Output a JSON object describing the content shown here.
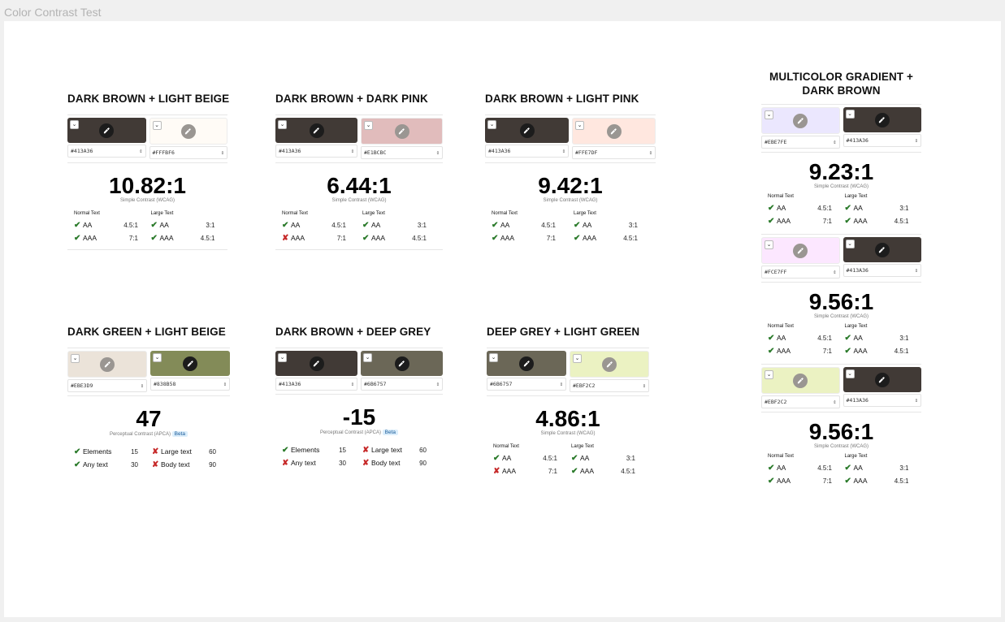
{
  "frame_title": "Color Contrast Test",
  "cards": {
    "c1": {
      "title": "DARK BROWN + LIGHT BEIGE",
      "left": {
        "hex": "#413A36",
        "color": "#413A36"
      },
      "right": {
        "hex": "#FFFBF6",
        "color": "#FFFBF6"
      },
      "score": "10.82:1",
      "score_label": "Simple Contrast (WCAG)",
      "normal_head": "Normal Text",
      "large_head": "Large Text",
      "rows": [
        {
          "n_label": "AA",
          "n_val": "4.5:1",
          "l_label": "AA",
          "l_val": "3:1"
        },
        {
          "n_label": "AAA",
          "n_val": "7:1",
          "l_label": "AAA",
          "l_val": "4.5:1"
        }
      ]
    },
    "c2": {
      "title": "DARK BROWN + DARK PINK",
      "left": {
        "hex": "#413A36",
        "color": "#413A36"
      },
      "right": {
        "hex": "#E1BCBC",
        "color": "#E1BCBC"
      },
      "score": "6.44:1",
      "score_label": "Simple Contrast (WCAG)",
      "normal_head": "Normal Text",
      "large_head": "Large Text",
      "rows": [
        {
          "n_label": "AA",
          "n_val": "4.5:1",
          "l_label": "AA",
          "l_val": "3:1"
        },
        {
          "n_label": "AAA",
          "n_val": "7:1",
          "l_label": "AAA",
          "l_val": "4.5:1"
        }
      ]
    },
    "c3": {
      "title": "DARK BROWN + LIGHT PINK",
      "left": {
        "hex": "#413A36",
        "color": "#413A36"
      },
      "right": {
        "hex": "#FFE7DF",
        "color": "#FFE7DF"
      },
      "score": "9.42:1",
      "score_label": "Simple Contrast (WCAG)",
      "normal_head": "Normal Text",
      "large_head": "Large Text",
      "rows": [
        {
          "n_label": "AA",
          "n_val": "4.5:1",
          "l_label": "AA",
          "l_val": "3:1"
        },
        {
          "n_label": "AAA",
          "n_val": "7:1",
          "l_label": "AAA",
          "l_val": "4.5:1"
        }
      ]
    },
    "c4": {
      "title": "DARK GREEN + LIGHT BEIGE",
      "left": {
        "hex": "#EBE3D9",
        "color": "#EBE3D9"
      },
      "right": {
        "hex": "#838B58",
        "color": "#838B58"
      },
      "score": "47",
      "score_label": "Perceptual Contrast (APCA)",
      "beta": "Beta",
      "rows": [
        {
          "n_label": "Elements",
          "n_val": "15",
          "l_label": "Large text",
          "l_val": "60"
        },
        {
          "n_label": "Any text",
          "n_val": "30",
          "l_label": "Body text",
          "l_val": "90"
        }
      ]
    },
    "c5": {
      "title": "DARK BROWN + DEEP GREY",
      "left": {
        "hex": "#413A36",
        "color": "#413A36"
      },
      "right": {
        "hex": "#6B6757",
        "color": "#6B6757"
      },
      "score": "-15",
      "score_label": "Perceptual Contrast (APCA)",
      "beta": "Beta",
      "rows": [
        {
          "n_label": "Elements",
          "n_val": "15",
          "l_label": "Large text",
          "l_val": "60"
        },
        {
          "n_label": "Any text",
          "n_val": "30",
          "l_label": "Body text",
          "l_val": "90"
        }
      ]
    },
    "c6": {
      "title": "DEEP GREY + LIGHT GREEN",
      "left": {
        "hex": "#6B6757",
        "color": "#6B6757"
      },
      "right": {
        "hex": "#EBF2C2",
        "color": "#EBF2C2"
      },
      "score": "4.86:1",
      "score_label": "Simple Contrast (WCAG)",
      "normal_head": "Normal Text",
      "large_head": "Large Text",
      "rows": [
        {
          "n_label": "AA",
          "n_val": "4.5:1",
          "l_label": "AA",
          "l_val": "3:1"
        },
        {
          "n_label": "AAA",
          "n_val": "7:1",
          "l_label": "AAA",
          "l_val": "4.5:1"
        }
      ]
    },
    "c7": {
      "title": "MULTICOLOR GRADIENT + DARK BROWN",
      "tests": [
        {
          "left": {
            "hex": "#EBE7FE",
            "color": "#EBE7FE"
          },
          "right": {
            "hex": "#413A36",
            "color": "#413A36"
          },
          "score": "9.23:1",
          "score_label": "Simple Contrast (WCAG)",
          "normal_head": "Normal Text",
          "large_head": "Large Text",
          "rows": [
            {
              "n_label": "AA",
              "n_val": "4.5:1",
              "l_label": "AA",
              "l_val": "3:1"
            },
            {
              "n_label": "AAA",
              "n_val": "7:1",
              "l_label": "AAA",
              "l_val": "4.5:1"
            }
          ]
        },
        {
          "left": {
            "hex": "#FCE7FF",
            "color": "#FCE7FF"
          },
          "right": {
            "hex": "#413A36",
            "color": "#413A36"
          },
          "score": "9.56:1",
          "score_label": "Simple Contrast (WCAG)",
          "normal_head": "Normal Text",
          "large_head": "Large Text",
          "rows": [
            {
              "n_label": "AA",
              "n_val": "4.5:1",
              "l_label": "AA",
              "l_val": "3:1"
            },
            {
              "n_label": "AAA",
              "n_val": "7:1",
              "l_label": "AAA",
              "l_val": "4.5:1"
            }
          ]
        },
        {
          "left": {
            "hex": "#EBF2C2",
            "color": "#EBF2C2"
          },
          "right": {
            "hex": "#413A36",
            "color": "#413A36"
          },
          "score": "9.56:1",
          "score_label": "Simple Contrast (WCAG)",
          "normal_head": "Normal Text",
          "large_head": "Large Text",
          "rows": [
            {
              "n_label": "AA",
              "n_val": "4.5:1",
              "l_label": "AA",
              "l_val": "3:1"
            },
            {
              "n_label": "AAA",
              "n_val": "7:1",
              "l_label": "AAA",
              "l_val": "4.5:1"
            }
          ]
        }
      ]
    }
  },
  "icons": {
    "pass": "checkmark-icon",
    "fail": "cross-icon",
    "eyedropper": "eyedropper-icon",
    "chevron": "chevron-down-icon",
    "updown": "updown-icon"
  },
  "colors": {
    "pass": "#2A7A2A",
    "fail": "#C62828",
    "beta_bg": "#DCEEFB"
  }
}
